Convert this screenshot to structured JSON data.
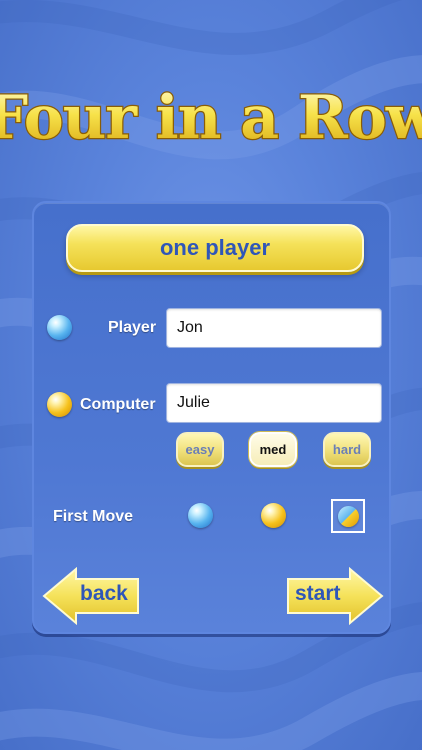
{
  "title": "Four in a Row",
  "mode_button": "one player",
  "player": {
    "label": "Player",
    "name_value": "Jon",
    "piece": "blue-ball-icon"
  },
  "computer": {
    "label": "Computer",
    "name_value": "Julie",
    "piece": "yellow-ball-icon"
  },
  "difficulty": {
    "options": [
      "easy",
      "med",
      "hard"
    ],
    "selected": "med"
  },
  "first_move": {
    "label": "First Move",
    "options": [
      "blue-ball-icon",
      "yellow-ball-icon",
      "half-ball-icon"
    ],
    "selected": "half-ball-icon"
  },
  "nav": {
    "back_label": "back",
    "start_label": "start"
  },
  "colors": {
    "background": "#5a83db",
    "panel": "#4f78d3",
    "button_yellow": "#f5e25a",
    "button_text": "#2f56b8",
    "title_fill": "#f7e24a"
  }
}
